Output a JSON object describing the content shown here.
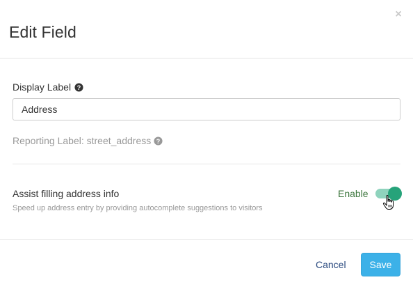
{
  "dialog": {
    "title": "Edit Field",
    "close_icon": "close-icon",
    "close_glyph": "×"
  },
  "display_label": {
    "label": "Display Label",
    "help_icon": "question-circle-icon",
    "value": "Address"
  },
  "reporting_label": {
    "text": "Reporting Label: street_address",
    "help_icon": "question-circle-icon"
  },
  "assist": {
    "title": "Assist filling address info",
    "description": "Speed up address entry by providing autocomplete suggestions to visitors",
    "toggle_label": "Enable",
    "enabled": true
  },
  "footer": {
    "cancel_label": "Cancel",
    "save_label": "Save"
  },
  "colors": {
    "primary_button": "#3cb1e8",
    "toggle_on": "#26a37a",
    "toggle_track": "#8fd3bd",
    "enable_text": "#3c763d",
    "muted_text": "#999999"
  }
}
